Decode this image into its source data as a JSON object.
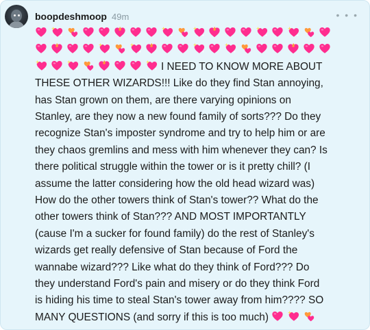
{
  "post": {
    "username": "boopdeshmoop",
    "timestamp": "49m",
    "more_label": "• • •",
    "emoji_rows": [
      [
        "heart",
        "sparkle",
        "revolving",
        "heart",
        "heart",
        "fire",
        "heart",
        "heart",
        "sparkle",
        "revolving",
        "sparkle",
        "fire",
        "heart",
        "heart",
        "sparkle",
        "heart",
        "sparkle",
        "revolving",
        "heart"
      ],
      [
        "heart",
        "fire",
        "heart",
        "heart",
        "sparkle",
        "revolving",
        "sparkle",
        "fire",
        "heart",
        "heart",
        "sparkle",
        "heart",
        "sparkle",
        "revolving",
        "heart",
        "heart",
        "fire",
        "heart",
        "heart"
      ],
      [
        "sparkle",
        "heart",
        "sparkle",
        "revolving",
        "fire",
        "heart",
        "heart",
        "sparkle"
      ]
    ],
    "lines": [
      "I NEED TO KNOW MORE ABOUT",
      "THESE OTHER WIZARDS!!! Like do they find Stan annoying,",
      "has Stan grown on them, are there varying opinions on",
      "Stanley, are they now a new found family of sorts??? Do they",
      "recognize Stan's imposter syndrome and try to help him or are",
      "they chaos gremlins and mess with him whenever they can? Is",
      "there political struggle within the tower or is it pretty chill? (I",
      "assume the latter considering how the old head wizard was)",
      "How do the other towers think of Stan's tower?? What do the",
      "other towers think of Stan??? AND MOST IMPORTANTLY",
      "(cause I'm a sucker for found family) do the rest of Stanley's",
      "wizards get really defensive of Stan because of Ford the",
      "wannabe wizard??? Like what do they think of Ford??? Do",
      "they understand Ford's pain and misery or do they think Ford",
      "is hiding his time to steal Stan's tower away from him???? SO",
      "MANY QUESTIONS (and sorry if this is too much)"
    ],
    "trailing_emojis": [
      "heart",
      "sparkle",
      "revolving"
    ],
    "colors": {
      "card_bg": "#e6f5fb",
      "heart": "#ff2d8f",
      "accent": "#ff9a3c"
    }
  }
}
